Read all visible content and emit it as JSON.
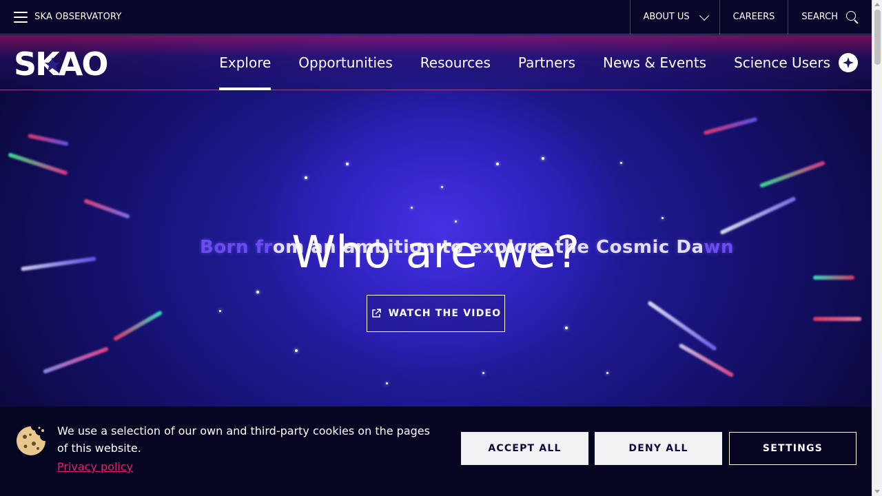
{
  "topbar": {
    "menu_label": "SKA OBSERVATORY",
    "about_label": "ABOUT US",
    "careers_label": "CAREERS",
    "search_label": "SEARCH"
  },
  "nav": {
    "logo_text": "SKAO",
    "items": [
      {
        "label": "Explore",
        "active": true
      },
      {
        "label": "Opportunities"
      },
      {
        "label": "Resources"
      },
      {
        "label": "Partners"
      },
      {
        "label": "News & Events"
      },
      {
        "label": "Science Users"
      }
    ]
  },
  "hero": {
    "tagline_lead": "Born fr",
    "tagline_mid": "om an ambition to explore the Cosmic Da",
    "tagline_tail": "wn",
    "title": "Who are we?",
    "video_button": "WATCH THE VIDEO"
  },
  "cookie": {
    "message": "We use a selection of our own and third-party cookies on the pages of this website.",
    "privacy_link": "Privacy policy",
    "accept_label": "ACCEPT ALL",
    "deny_label": "DENY ALL",
    "settings_label": "SETTINGS"
  },
  "colors": {
    "navy": "#070622",
    "hero_blue": "#2d24b8",
    "accent_pink": "#e0226a",
    "button_light": "#f2f2f4"
  },
  "icons": [
    "hamburger-icon",
    "chevron-down-icon",
    "search-icon",
    "compass-icon",
    "external-link-icon",
    "cookie-icon"
  ]
}
